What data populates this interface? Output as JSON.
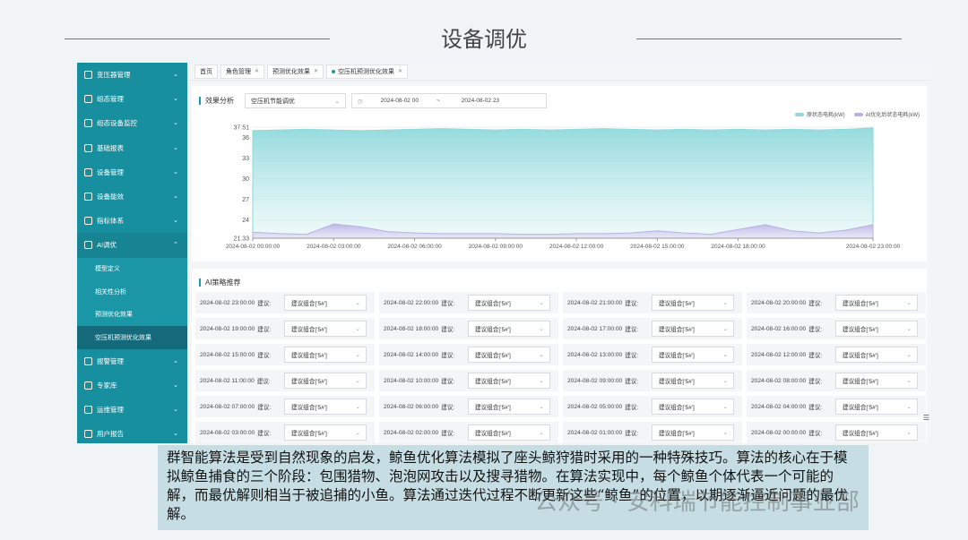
{
  "slide": {
    "title": "设备调优",
    "caption": "群智能算法是受到自然现象的启发，鲸鱼优化算法模拟了座头鲸狩猎时采用的一种特殊技巧。算法的核心在于模拟鲸鱼捕食的三个阶段：包围猎物、泡泡网攻击以及搜寻猎物。在算法实现中，每个鲸鱼个体代表一个可能的解，而最优解则相当于被追捕的小鱼。算法通过迭代过程不断更新这些“鲸鱼”的位置，以期逐渐逼近问题的最优解。",
    "watermark": "公众号 · 安科瑞节能控制事业部"
  },
  "sidebar": {
    "items": [
      {
        "label": "变压器管理",
        "icon": "transformer-icon"
      },
      {
        "label": "组态管理",
        "icon": "config-icon"
      },
      {
        "label": "组态设备监控",
        "icon": "monitor-icon"
      },
      {
        "label": "基础报表",
        "icon": "report-icon"
      },
      {
        "label": "设备管理",
        "icon": "device-icon"
      },
      {
        "label": "设备能效",
        "icon": "efficiency-icon"
      },
      {
        "label": "指标体系",
        "icon": "index-icon"
      },
      {
        "label": "AI调优",
        "icon": "ai-icon"
      }
    ],
    "sub_items": [
      "模型定义",
      "相关性分析",
      "预测优化效果",
      "空压机预测优化效果"
    ],
    "bottom_items": [
      {
        "label": "报警管理",
        "icon": "alarm-icon"
      },
      {
        "label": "专家库",
        "icon": "expert-icon"
      },
      {
        "label": "运维管理",
        "icon": "ops-icon"
      },
      {
        "label": "用户报告",
        "icon": "user-report-icon"
      }
    ]
  },
  "tabs": [
    "首页",
    "角色管理",
    "预测优化效果",
    "空压机预测优化效果"
  ],
  "analysis": {
    "label": "效果分析",
    "select_value": "空压机节能调优",
    "date_start": "2024-08-02 00",
    "date_sep": "~",
    "date_end": "2024-08-02 23"
  },
  "ai": {
    "label": "AI策略推荐",
    "advice_label": "建议:",
    "rows": [
      [
        "2024-08-02 23:00:00",
        "2024-08-02 22:00:00",
        "2024-08-02 21:00:00",
        "2024-08-02 20:00:00"
      ],
      [
        "2024-08-02 19:00:00",
        "2024-08-02 18:00:00",
        "2024-08-02 17:00:00",
        "2024-08-02 16:00:00"
      ],
      [
        "2024-08-02 15:00:00",
        "2024-08-02 14:00:00",
        "2024-08-02 13:00:00",
        "2024-08-02 12:00:00"
      ],
      [
        "2024-08-02 11:00:00",
        "2024-08-02 10:00:00",
        "2024-08-02 09:00:00",
        "2024-08-02 08:00:00"
      ],
      [
        "2024-08-02 07:00:00",
        "2024-08-02 06:00:00",
        "2024-08-02 05:00:00",
        "2024-08-02 04:00:00"
      ],
      [
        "2024-08-02 03:00:00",
        "2024-08-02 02:00:00",
        "2024-08-02 01:00:00",
        "2024-08-02 00:00:00"
      ]
    ],
    "suggestion": "建议组合['5#']"
  },
  "chart_data": {
    "type": "area",
    "x": [
      "2024-08-02 00:00:00",
      "2024-08-02 01:00:00",
      "2024-08-02 02:00:00",
      "2024-08-02 03:00:00",
      "2024-08-02 04:00:00",
      "2024-08-02 05:00:00",
      "2024-08-02 06:00:00",
      "2024-08-02 07:00:00",
      "2024-08-02 08:00:00",
      "2024-08-02 09:00:00",
      "2024-08-02 10:00:00",
      "2024-08-02 11:00:00",
      "2024-08-02 12:00:00",
      "2024-08-02 13:00:00",
      "2024-08-02 14:00:00",
      "2024-08-02 15:00:00",
      "2024-08-02 16:00:00",
      "2024-08-02 17:00:00",
      "2024-08-02 18:00:00",
      "2024-08-02 19:00:00",
      "2024-08-02 20:00:00",
      "2024-08-02 21:00:00",
      "2024-08-02 22:00:00",
      "2024-08-02 23:00:00"
    ],
    "x_tick_labels": [
      "2024-08-02 00:00:00",
      "2024-08-02 03:00:00",
      "2024-08-02 06:00:00",
      "2024-08-02 09:00:00",
      "2024-08-02 12:00:00",
      "2024-08-02 15:00:00",
      "2024-08-02 18:00:00",
      "2024-08-02 23:00:00"
    ],
    "y_ticks": [
      "37.51",
      "36",
      "33",
      "30",
      "27",
      "24",
      "21.33"
    ],
    "ylim": [
      21.33,
      37.51
    ],
    "series": [
      {
        "name": "原状态电耗(kW)",
        "color": "#8fd9dc",
        "values": [
          37.0,
          37.1,
          37.2,
          37.1,
          37.0,
          37.1,
          37.2,
          37.3,
          37.2,
          37.1,
          37.2,
          37.1,
          37.2,
          37.3,
          37.2,
          37.1,
          37.2,
          37.1,
          37.2,
          37.1,
          37.2,
          37.1,
          37.2,
          37.4
        ]
      },
      {
        "name": "AI优化后状态电耗(kW)",
        "color": "#b9b1e3",
        "values": [
          22.2,
          22.0,
          21.9,
          23.4,
          23.0,
          22.3,
          22.1,
          22.0,
          22.0,
          22.0,
          21.9,
          21.9,
          22.0,
          22.0,
          22.1,
          22.4,
          22.1,
          21.9,
          22.6,
          23.3,
          22.4,
          22.1,
          22.5,
          23.3
        ]
      }
    ]
  }
}
